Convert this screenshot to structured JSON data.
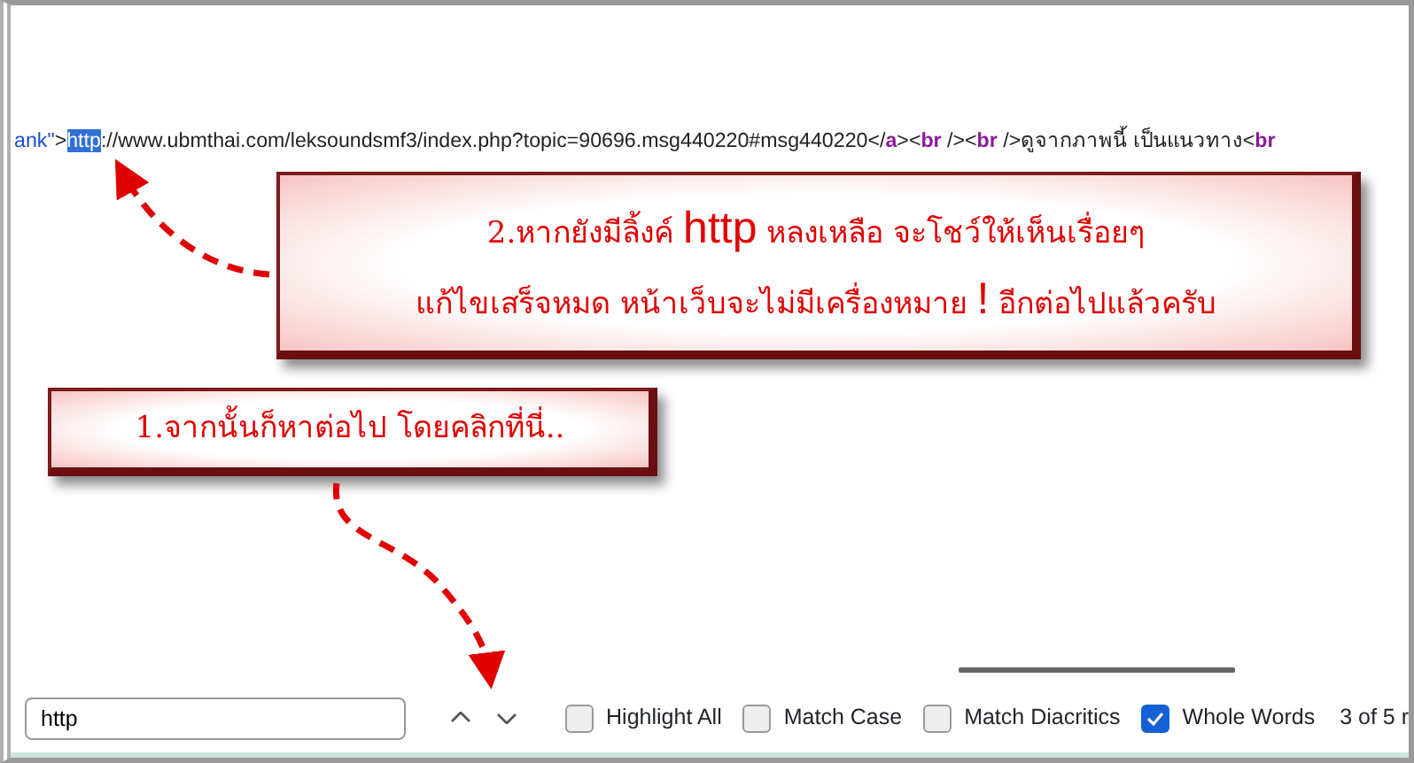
{
  "source_line": [
    {
      "text": "ank\"",
      "kind": "value"
    },
    {
      "text": ">",
      "kind": "plain"
    },
    {
      "text": "http",
      "kind": "match"
    },
    {
      "text": "://www.ubmthai.com/leksoundsmf3/index.php?topic=90696.msg440220#msg440220</",
      "kind": "plain"
    },
    {
      "text": "a",
      "kind": "tag"
    },
    {
      "text": "><",
      "kind": "plain"
    },
    {
      "text": "br",
      "kind": "tag"
    },
    {
      "text": " /><",
      "kind": "plain"
    },
    {
      "text": "br",
      "kind": "tag"
    },
    {
      "text": " />ดูจากภาพนี้ เป็นแนวทาง<",
      "kind": "plain"
    },
    {
      "text": "br",
      "kind": "tag"
    }
  ],
  "callouts": [
    {
      "lines": [
        [
          {
            "text": "2.หากยังมีลิ้งค์ ",
            "kind": "thai"
          },
          {
            "text": "http",
            "kind": "latin"
          },
          {
            "text": " หลงเหลือ จะโชว์ให้เห็นเรื่อยๆ",
            "kind": "thai"
          }
        ],
        [
          {
            "text": "แก้ไขเสร็จหมด หน้าเว็บจะไม่มีเครื่องหมาย ",
            "kind": "thai"
          },
          {
            "text": "!",
            "kind": "latin"
          },
          {
            "text": " อีกต่อไปแล้วครับ",
            "kind": "thai"
          }
        ]
      ]
    },
    {
      "lines": [
        [
          {
            "text": "1.จากนั้นก็หาต่อไป โดยคลิกที่นี่..",
            "kind": "thai"
          }
        ]
      ]
    }
  ],
  "find_bar": {
    "value": "http",
    "options": [
      {
        "label": "Highlight All",
        "checked": false
      },
      {
        "label": "Match Case",
        "checked": false
      },
      {
        "label": "Match Diacritics",
        "checked": false
      },
      {
        "label": "Whole Words",
        "checked": true
      }
    ],
    "result": "3 of 5 r"
  }
}
